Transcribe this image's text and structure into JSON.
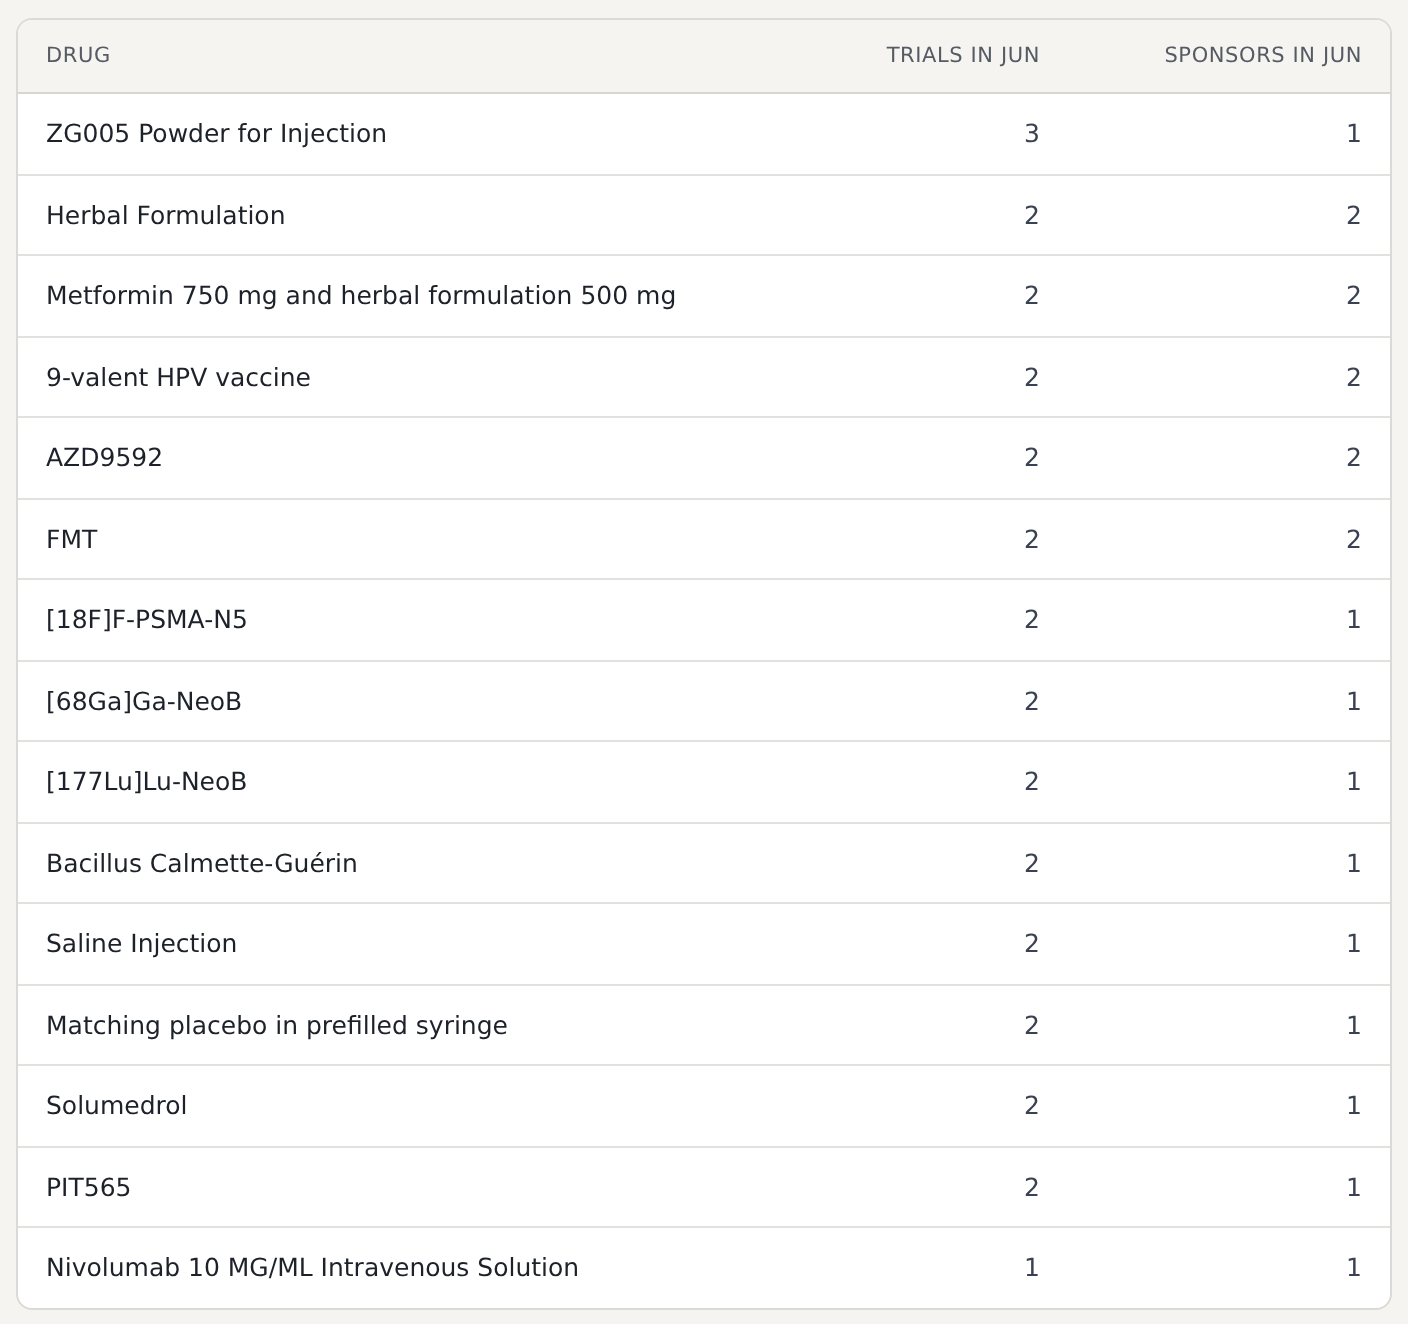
{
  "table": {
    "columns": [
      "DRUG",
      "TRIALS IN JUN",
      "SPONSORS IN JUN"
    ],
    "rows": [
      [
        "ZG005 Powder for Injection",
        "3",
        "1"
      ],
      [
        "Herbal Formulation",
        "2",
        "2"
      ],
      [
        "Metformin 750 mg and herbal formulation 500 mg",
        "2",
        "2"
      ],
      [
        "9-valent HPV vaccine",
        "2",
        "2"
      ],
      [
        "AZD9592",
        "2",
        "2"
      ],
      [
        "FMT",
        "2",
        "2"
      ],
      [
        "[18F]F-PSMA-N5",
        "2",
        "1"
      ],
      [
        "[68Ga]Ga-NeoB",
        "2",
        "1"
      ],
      [
        "[177Lu]Lu-NeoB",
        "2",
        "1"
      ],
      [
        "Bacillus Calmette-Guérin",
        "2",
        "1"
      ],
      [
        "Saline Injection",
        "2",
        "1"
      ],
      [
        "Matching placebo in prefilled syringe",
        "2",
        "1"
      ],
      [
        "Solumedrol",
        "2",
        "1"
      ],
      [
        "PIT565",
        "2",
        "1"
      ],
      [
        "Nivolumab 10 MG/ML Intravenous Solution",
        "1",
        "1"
      ]
    ]
  }
}
